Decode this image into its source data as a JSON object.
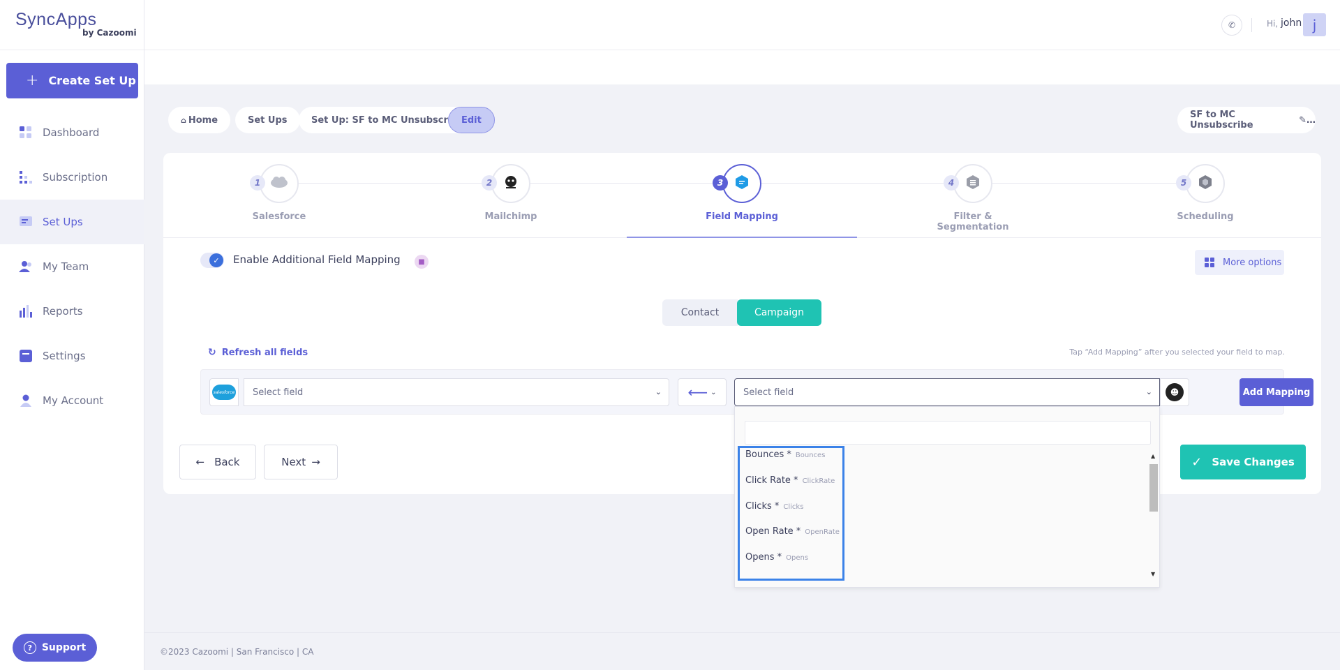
{
  "brand": {
    "name": "SyncApps",
    "sub": "by Cazoomi"
  },
  "sidebar": {
    "create_label": "Create Set Up",
    "items": [
      {
        "label": "Dashboard",
        "icon": "dashboard-icon"
      },
      {
        "label": "Subscription",
        "icon": "subscription-icon"
      },
      {
        "label": "Set Ups",
        "icon": "setups-icon"
      },
      {
        "label": "My Team",
        "icon": "team-icon"
      },
      {
        "label": "Reports",
        "icon": "reports-icon"
      },
      {
        "label": "Settings",
        "icon": "settings-icon"
      },
      {
        "label": "My Account",
        "icon": "account-icon"
      }
    ],
    "support_label": "Support"
  },
  "header": {
    "greeting": "Hi,",
    "user": "john",
    "avatar_letter": "j"
  },
  "breadcrumbs": [
    "Home",
    "Set Ups",
    "Set Up: SF to MC Unsubscribe",
    "Edit"
  ],
  "setup_name": "SF to MC Unsubscribe",
  "steps": [
    {
      "num": "1",
      "label": "Salesforce"
    },
    {
      "num": "2",
      "label": "Mailchimp"
    },
    {
      "num": "3",
      "label": "Field Mapping"
    },
    {
      "num": "4",
      "label": "Filter & Segmentation"
    },
    {
      "num": "5",
      "label": "Scheduling"
    }
  ],
  "mapping": {
    "toggle_label": "Enable Additional Field Mapping",
    "more_options": "More options",
    "tabs": [
      "Contact",
      "Campaign"
    ],
    "active_tab": "Campaign",
    "refresh_label": "Refresh all fields",
    "hint": "Tap “Add Mapping” after you selected your field to map.",
    "left_placeholder": "Select field",
    "right_placeholder": "Select field",
    "add_label": "Add Mapping",
    "sf_logo_text": "salesforce"
  },
  "dropdown": {
    "search_value": "",
    "options": [
      {
        "label": "Bounces *",
        "api": "Bounces"
      },
      {
        "label": "Click Rate *",
        "api": "ClickRate"
      },
      {
        "label": "Clicks *",
        "api": "Clicks"
      },
      {
        "label": "Open Rate *",
        "api": "OpenRate"
      },
      {
        "label": "Opens *",
        "api": "Opens"
      }
    ]
  },
  "actions": {
    "back": "Back",
    "next": "Next",
    "save": "Save Changes"
  },
  "footer": "©2023 Cazoomi | San Francisco | CA",
  "colors": {
    "primary": "#5b5fd6",
    "teal": "#1fc3b3",
    "highlight": "#3b82e8"
  }
}
